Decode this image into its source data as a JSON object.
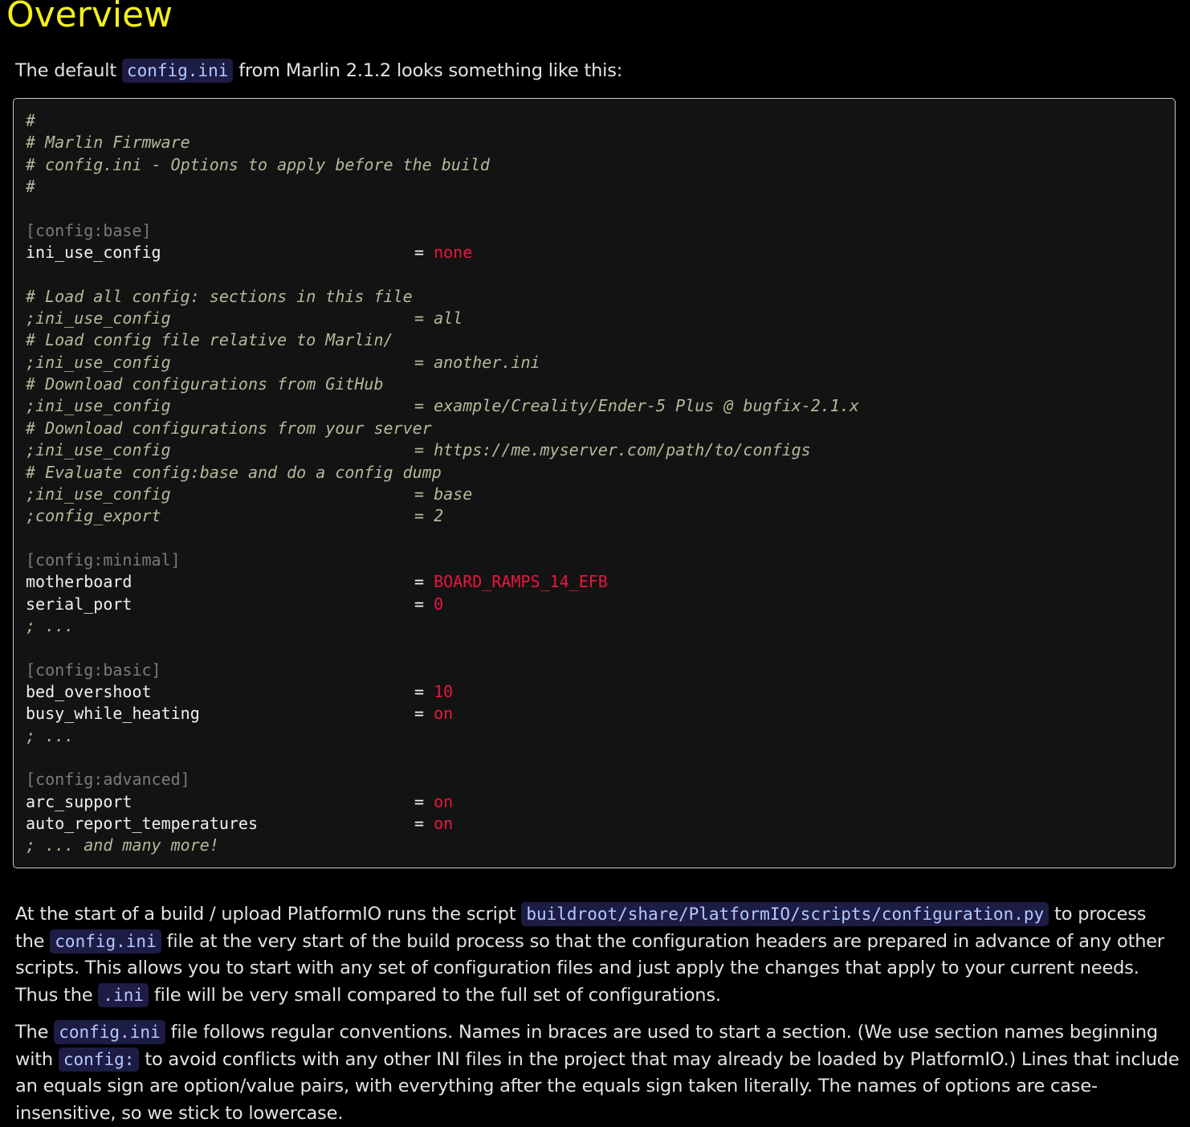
{
  "heading": "Overview",
  "intro": {
    "before": "The default ",
    "code": "config.ini",
    "after": " from Marlin 2.1.2 looks something like this:"
  },
  "code_lines": [
    {
      "type": "comment",
      "text": "#"
    },
    {
      "type": "comment",
      "text": "# Marlin Firmware"
    },
    {
      "type": "comment",
      "text": "# config.ini - Options to apply before the build"
    },
    {
      "type": "comment",
      "text": "#"
    },
    {
      "type": "blank",
      "text": ""
    },
    {
      "type": "section",
      "text": "[config:base]"
    },
    {
      "type": "kv",
      "key": "ini_use_config",
      "value": "none"
    },
    {
      "type": "blank",
      "text": ""
    },
    {
      "type": "comment",
      "text": "# Load all config: sections in this file"
    },
    {
      "type": "ckv",
      "key": ";ini_use_config",
      "value": "all"
    },
    {
      "type": "comment",
      "text": "# Load config file relative to Marlin/"
    },
    {
      "type": "ckv",
      "key": ";ini_use_config",
      "value": "another.ini"
    },
    {
      "type": "comment",
      "text": "# Download configurations from GitHub"
    },
    {
      "type": "ckv",
      "key": ";ini_use_config",
      "value": "example/Creality/Ender-5 Plus @ bugfix-2.1.x"
    },
    {
      "type": "comment",
      "text": "# Download configurations from your server"
    },
    {
      "type": "ckv",
      "key": ";ini_use_config",
      "value": "https://me.myserver.com/path/to/configs"
    },
    {
      "type": "comment",
      "text": "# Evaluate config:base and do a config dump"
    },
    {
      "type": "ckv",
      "key": ";ini_use_config",
      "value": "base"
    },
    {
      "type": "ckv",
      "key": ";config_export",
      "value": "2"
    },
    {
      "type": "blank",
      "text": ""
    },
    {
      "type": "section",
      "text": "[config:minimal]"
    },
    {
      "type": "kv",
      "key": "motherboard",
      "value": "BOARD_RAMPS_14_EFB"
    },
    {
      "type": "kv",
      "key": "serial_port",
      "value": "0"
    },
    {
      "type": "comment",
      "text": "; ..."
    },
    {
      "type": "blank",
      "text": ""
    },
    {
      "type": "section",
      "text": "[config:basic]"
    },
    {
      "type": "kv",
      "key": "bed_overshoot",
      "value": "10"
    },
    {
      "type": "kv",
      "key": "busy_while_heating",
      "value": "on"
    },
    {
      "type": "comment",
      "text": "; ..."
    },
    {
      "type": "blank",
      "text": ""
    },
    {
      "type": "section",
      "text": "[config:advanced]"
    },
    {
      "type": "kv",
      "key": "arc_support",
      "value": "on"
    },
    {
      "type": "kv",
      "key": "auto_report_temperatures",
      "value": "on"
    },
    {
      "type": "comment",
      "text": "; ... and many more!"
    }
  ],
  "para1": {
    "t1": "At the start of a build / upload PlatformIO runs the script ",
    "c1": "buildroot/share/PlatformIO/scripts/configuration.py",
    "t2": " to process the ",
    "c2": "config.ini",
    "t3": " file at the very start of the build process so that the configuration headers are prepared in advance of any other scripts. This allows you to start with any set of configuration files and just apply the changes that apply to your current needs. Thus the ",
    "c3": ".ini",
    "t4": " file will be very small compared to the full set of configurations."
  },
  "para2": {
    "t1": "The ",
    "c1": "config.ini",
    "t2": " file follows regular conventions. Names in braces are used to start a section. (We use section names beginning with ",
    "c2": "config:",
    "t3": " to avoid conflicts with any other INI files in the project that may already be loaded by PlatformIO.) Lines that include an equals sign are option/value pairs, with everything after the equals sign taken literally. The names of options are case-insensitive, so we stick to lowercase."
  },
  "colors": {
    "heading": "#f2f01c",
    "code_value": "#e8173e",
    "code_comment": "#b8b89a",
    "code_section": "#7a7a7a",
    "inline_code_bg": "#1c1c45",
    "inline_code_text": "#b4c8ff"
  }
}
